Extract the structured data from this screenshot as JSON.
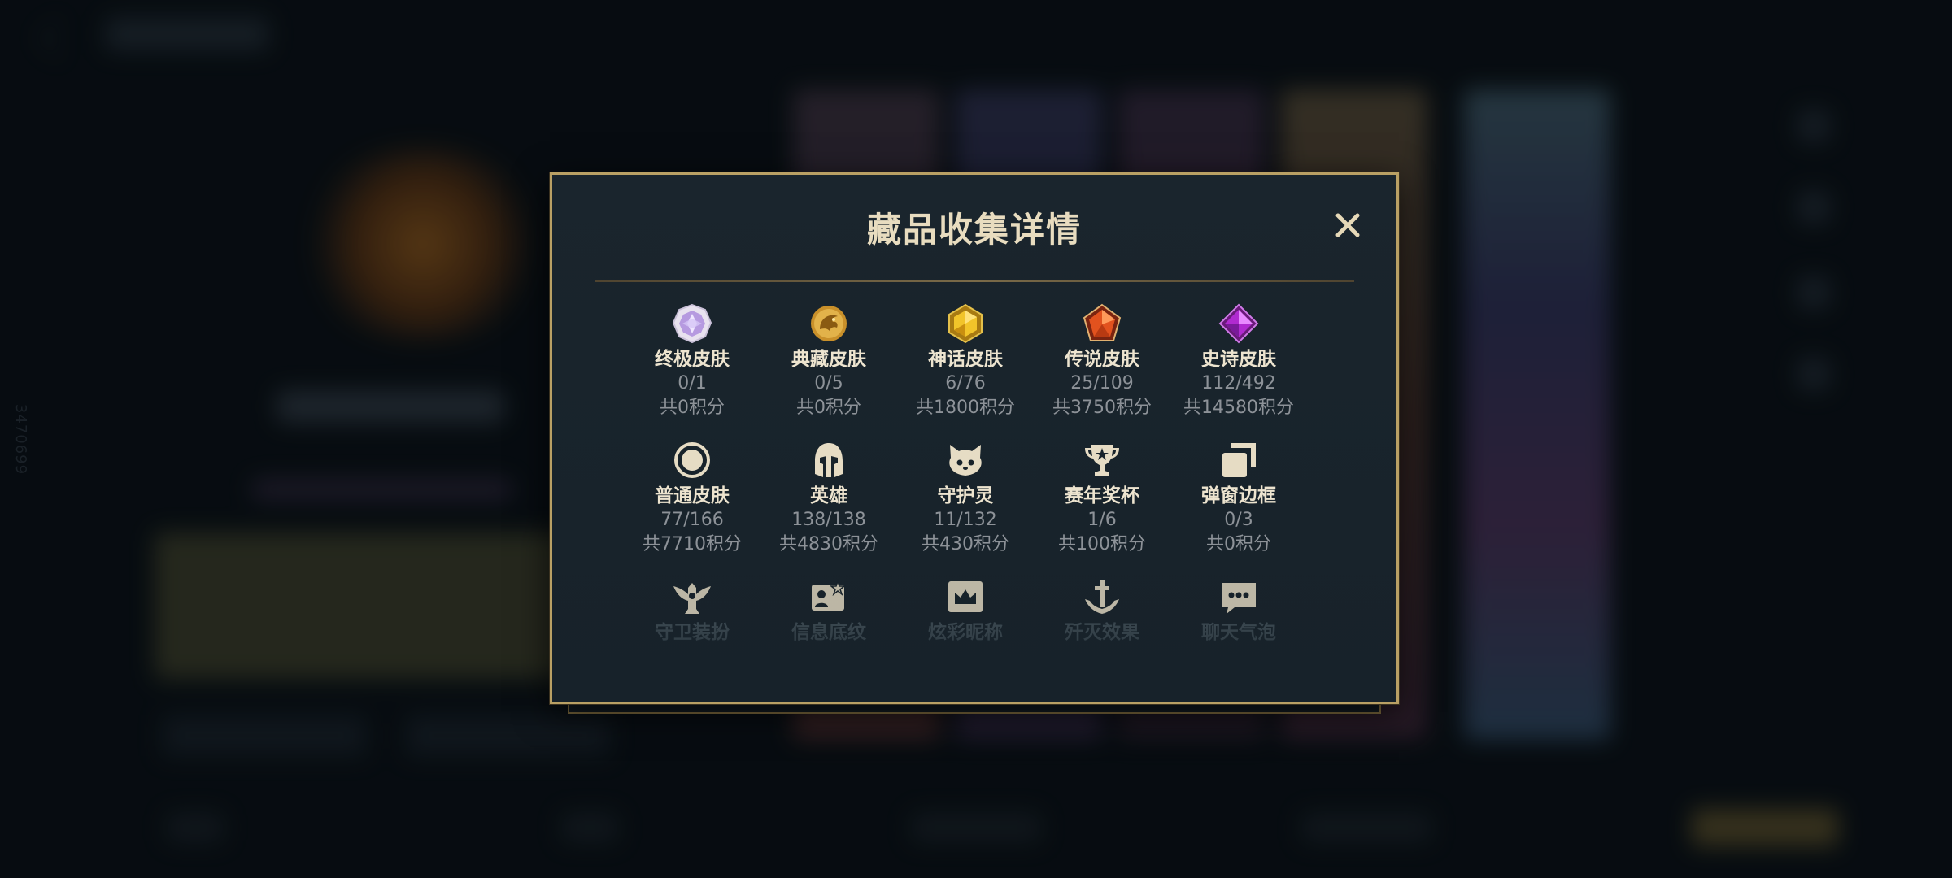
{
  "modal": {
    "title": "藏品收集详情",
    "close_icon": "close-icon"
  },
  "background": {
    "side_code": "3470699"
  },
  "categories": [
    {
      "icon": "ultimate-skin-gem-icon",
      "name": "终极皮肤",
      "count": "0/1",
      "points": "共0积分"
    },
    {
      "icon": "prestige-skin-dragon-icon",
      "name": "典藏皮肤",
      "count": "0/5",
      "points": "共0积分"
    },
    {
      "icon": "mythic-skin-gem-icon",
      "name": "神话皮肤",
      "count": "6/76",
      "points": "共1800积分"
    },
    {
      "icon": "legendary-skin-gem-icon",
      "name": "传说皮肤",
      "count": "25/109",
      "points": "共3750积分"
    },
    {
      "icon": "epic-skin-gem-icon",
      "name": "史诗皮肤",
      "count": "112/492",
      "points": "共14580积分"
    },
    {
      "icon": "common-skin-circle-icon",
      "name": "普通皮肤",
      "count": "77/166",
      "points": "共7710积分"
    },
    {
      "icon": "champion-helmet-icon",
      "name": "英雄",
      "count": "138/138",
      "points": "共4830积分"
    },
    {
      "icon": "guardian-spirit-icon",
      "name": "守护灵",
      "count": "11/132",
      "points": "共430积分"
    },
    {
      "icon": "season-trophy-icon",
      "name": "赛年奖杯",
      "count": "1/6",
      "points": "共100积分"
    },
    {
      "icon": "popup-frame-icon",
      "name": "弹窗边框",
      "count": "0/3",
      "points": "共0积分"
    },
    {
      "icon": "guardian-outfit-icon",
      "name": "守卫装扮"
    },
    {
      "icon": "info-card-icon",
      "name": "信息底纹"
    },
    {
      "icon": "crown-nickname-icon",
      "name": "炫彩昵称"
    },
    {
      "icon": "anchor-elimination-icon",
      "name": "歼灭效果"
    },
    {
      "icon": "chat-bubble-icon",
      "name": "聊天气泡"
    }
  ],
  "colors": {
    "gold_border": "#b9a064",
    "title_text": "#e8dcbf",
    "muted_text": "#8d9298",
    "panel_bg": "#17222a"
  }
}
